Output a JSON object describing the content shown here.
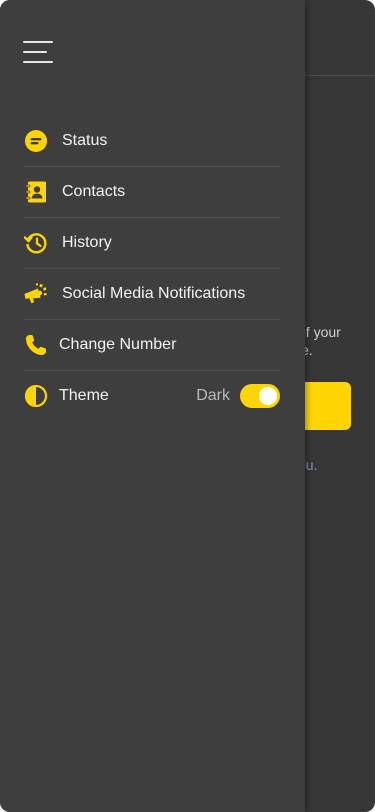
{
  "background": {
    "line1": "of your",
    "line2": "le.",
    "link": "ou."
  },
  "drawer": {
    "menu_icon": "hamburger-icon",
    "items": [
      {
        "id": "status",
        "label": "Status",
        "icon": "status-icon"
      },
      {
        "id": "contacts",
        "label": "Contacts",
        "icon": "contacts-book-icon"
      },
      {
        "id": "history",
        "label": "History",
        "icon": "history-clock-icon"
      },
      {
        "id": "social",
        "label": "Social Media Notifications",
        "icon": "megaphone-icon"
      },
      {
        "id": "change-number",
        "label": "Change Number",
        "icon": "phone-icon"
      },
      {
        "id": "theme",
        "label": "Theme",
        "icon": "half-circle-theme-icon",
        "value": "Dark",
        "toggle_on": true
      }
    ]
  },
  "colors": {
    "accent": "#FFD500",
    "drawer_bg": "#3E3E3E",
    "page_bg": "#373737"
  }
}
